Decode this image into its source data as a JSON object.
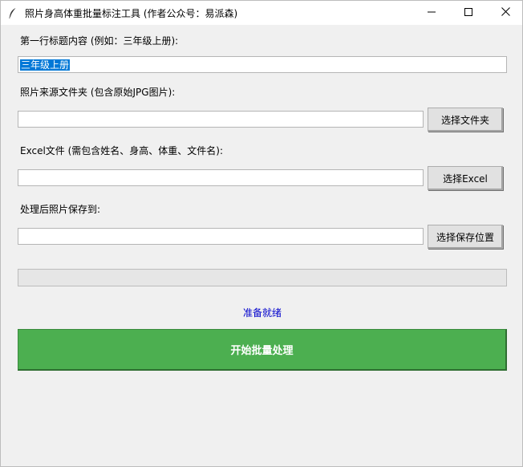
{
  "window": {
    "title": "照片身高体重批量标注工具 (作者公众号：易派森)"
  },
  "form": {
    "title_label": "第一行标题内容 (例如：三年级上册):",
    "title_value": "三年级上册",
    "source_label": "照片来源文件夹 (包含原始JPG图片):",
    "source_value": "",
    "source_button": "选择文件夹",
    "excel_label": "Excel文件 (需包含姓名、身高、体重、文件名):",
    "excel_value": "",
    "excel_button": "选择Excel",
    "output_label": "处理后照片保存到:",
    "output_value": "",
    "output_button": "选择保存位置"
  },
  "progress": {
    "value": 0
  },
  "status": {
    "text": "准备就绪",
    "color": "#0000cc"
  },
  "actions": {
    "start_label": "开始批量处理",
    "start_color": "#4caf50"
  },
  "icons": {
    "app": "feather-icon",
    "minimize": "minimize-icon",
    "maximize": "maximize-icon",
    "close": "close-icon"
  }
}
